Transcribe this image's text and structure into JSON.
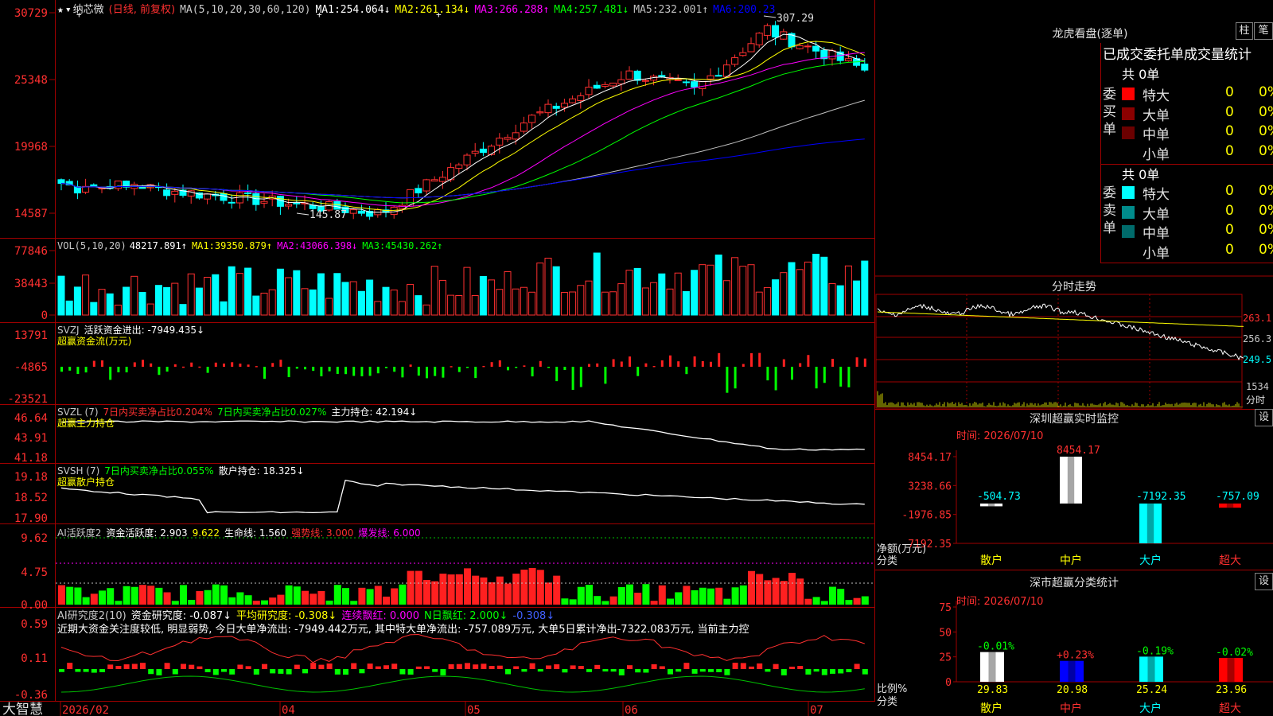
{
  "app": {
    "brand": "大智慧"
  },
  "stock": {
    "name": "纳芯微",
    "mode": "(日线, 前复权)",
    "star": "★",
    "menu": "▾"
  },
  "ma_line": {
    "label": "MA(5,10,20,30,60,120)",
    "items": [
      {
        "name": "MA1:",
        "value": "254.064↓",
        "color": "#ffffff"
      },
      {
        "name": "MA2:",
        "value": "261.134↓",
        "color": "#ffff00"
      },
      {
        "name": "MA3:",
        "value": "266.288↑",
        "color": "#ff00ff"
      },
      {
        "name": "MA4:",
        "value": "257.481↓",
        "color": "#00ff00"
      },
      {
        "name": "MA5:",
        "value": "232.001↑",
        "color": "#c0c0c0"
      },
      {
        "name": "MA6:",
        "value": "200.23",
        "color": "#0000ff"
      }
    ]
  },
  "price_axis": [
    "30729",
    "25348",
    "19968",
    "14587"
  ],
  "price_annotations": {
    "high": "307.29",
    "low": "145.87"
  },
  "vol": {
    "label": "VOL(5,10,20)",
    "value": "48217.891↑",
    "items": [
      {
        "name": "MA1:",
        "value": "39350.879↑",
        "color": "#ffff00"
      },
      {
        "name": "MA2:",
        "value": "43066.398↓",
        "color": "#ff00ff"
      },
      {
        "name": "MA3:",
        "value": "45430.262↑",
        "color": "#00ff00"
      }
    ],
    "axis": [
      "77846",
      "38443",
      "0"
    ]
  },
  "svzj": {
    "label": "SVZJ",
    "text": "活跃资金进出: -7949.435↓",
    "line2": "超赢资金流(万元)",
    "axis": [
      "13791",
      "-4865",
      "-23521"
    ]
  },
  "svzl": {
    "label": "SVZL (7)",
    "t1": "7日内买卖净占比0.204%",
    "t2": "7日内买卖净占比0.027%",
    "t3": "主力持仓: 42.194↓",
    "line2": "超赢主力持仓",
    "axis": [
      "46.64",
      "43.91",
      "41.18"
    ]
  },
  "svsh": {
    "label": "SVSH (7)",
    "t1": "7日内买卖净占比0.055%",
    "t2": "散户持仓: 18.325↓",
    "line2": "超赢散户持仓",
    "axis": [
      "19.18",
      "18.52",
      "17.90"
    ]
  },
  "ai1": {
    "label": "AI活跃度2",
    "t1": "资金活跃度: 2.903",
    "t2": "9.622",
    "t3": "生命线: 1.560",
    "t4": "强势线: 3.000",
    "t5": "爆发线: 6.000",
    "axis": [
      "9.62",
      "4.75",
      "0.00"
    ]
  },
  "ai2": {
    "label": "AI研究度2(10)",
    "t1": "资金研究度: -0.087↓",
    "t2": "平均研究度: -0.308↓",
    "t3": "连续飘红: 0.000",
    "t4": "N日飘红: 2.000↓",
    "t5": "-0.308↓",
    "comment": "近期大资金关注度较低, 明显弱势, 今日大单净流出: -7949.442万元, 其中特大单净流出: -757.089万元, 大单5日累计净出-7322.083万元, 当前主力控",
    "axis": [
      "0.59",
      "0.11",
      "-0.36"
    ]
  },
  "time_axis": [
    "2026/02",
    "04",
    "05",
    "06",
    "07"
  ],
  "right": {
    "lhb_title": "龙虎看盘(逐单)",
    "btn_col": "柱",
    "btn_pen": "笔",
    "stat_header": "已成交委托单成交量统计",
    "buy_label": "委买单",
    "sell_label": "委卖单",
    "buy_total": "共 0单",
    "sell_total": "共 0单",
    "buy_rows": [
      {
        "name": "特大",
        "count": "0",
        "pct": "0%",
        "color": "#ff0000"
      },
      {
        "name": "大单",
        "count": "0",
        "pct": "0%",
        "color": "#8b0000"
      },
      {
        "name": "中单",
        "count": "0",
        "pct": "0%",
        "color": "#6b0000"
      },
      {
        "name": "小单",
        "count": "0",
        "pct": "0%",
        "color": "#000000"
      }
    ],
    "sell_rows": [
      {
        "name": "特大",
        "count": "0",
        "pct": "0%",
        "color": "#00ffff"
      },
      {
        "name": "大单",
        "count": "0",
        "pct": "0%",
        "color": "#008b8b"
      },
      {
        "name": "中单",
        "count": "0",
        "pct": "0%",
        "color": "#006b6b"
      },
      {
        "name": "小单",
        "count": "0",
        "pct": "0%",
        "color": "#000000"
      }
    ],
    "fenshi_title": "分时走势",
    "fenshi_axis": [
      "263.1",
      "256.3",
      "249.5"
    ],
    "fenshi_vol": "1534",
    "fenshi_tag": "分时",
    "sz_title": "深圳超赢实时监控",
    "sz_time": "时间: 2026/07/10",
    "sz_axis": [
      "8454.17",
      "3238.66",
      "-1976.85",
      "-7192.35"
    ],
    "sz_ylabel": "净额(万元)",
    "sz_xlabel": "分类",
    "set": "设",
    "cls_title": "深市超赢分类统计",
    "cls_time": "时间: 2026/07/10",
    "cls_axis": [
      "75",
      "50",
      "25",
      "0"
    ],
    "cls_ylabel": "比例%",
    "cls_xlabel": "分类"
  },
  "chart_data": [
    {
      "type": "bar",
      "title": "深圳超赢实时监控",
      "ylabel": "净额(万元)",
      "xlabel": "分类",
      "categories": [
        "散户",
        "中户",
        "大户",
        "超大"
      ],
      "values": [
        -504.73,
        8454.17,
        -7192.35,
        -757.09
      ],
      "labels": [
        "-504.73",
        "8454.17",
        "-7192.35",
        "-757.09"
      ],
      "colors": [
        "#ffffff",
        "#ffffff",
        "#00ffff",
        "#ff0000"
      ],
      "ylim": [
        -7192.35,
        8454.17
      ]
    },
    {
      "type": "bar",
      "title": "深市超赢分类统计",
      "ylabel": "比例%",
      "xlabel": "分类",
      "categories": [
        "散户",
        "中户",
        "大户",
        "超大"
      ],
      "values": [
        29.83,
        20.98,
        25.24,
        23.96
      ],
      "changes": [
        "-0.01%",
        "+0.23%",
        "-0.19%",
        "-0.02%"
      ],
      "colors": [
        "#ffffff",
        "#0000ff",
        "#00ffff",
        "#ff0000"
      ],
      "ylim": [
        0,
        75
      ]
    }
  ]
}
